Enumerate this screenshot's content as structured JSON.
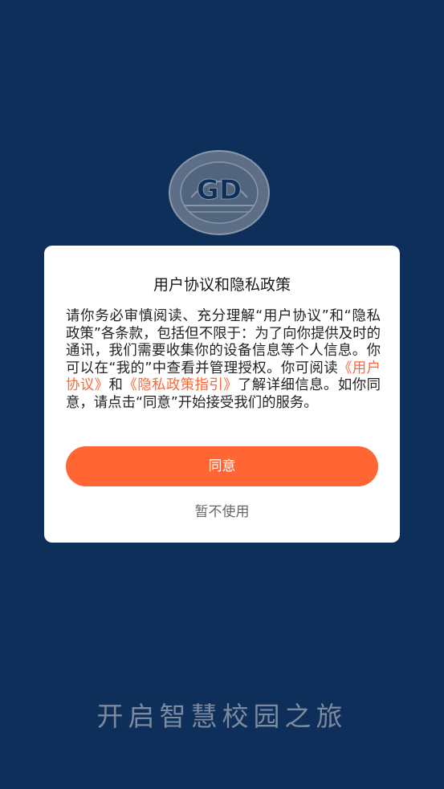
{
  "splash": {
    "slogan": "开启智慧校园之旅",
    "logo_text": "GD"
  },
  "dialog": {
    "title": "用户协议和隐私政策",
    "body_part1": "请你务必审慎阅读、充分理解“用户协议”和“隐私政策”各条款，包括但不限于：为了向你提供及时的通讯，我们需要收集你的设备信息等个人信息。你可以在“我的”中查看并管理授权。你可阅读",
    "user_agreement_link": "《用户协议》",
    "body_and": "和",
    "privacy_link": "《隐私政策指引》",
    "body_part2": "了解详细信息。如你同意，请点击“同意”开始接受我们的服务。",
    "agree_label": "同意",
    "decline_label": "暂不使用"
  },
  "colors": {
    "background": "#0d2f5a",
    "accent": "#ff6633",
    "dialog_bg": "#ffffff"
  }
}
